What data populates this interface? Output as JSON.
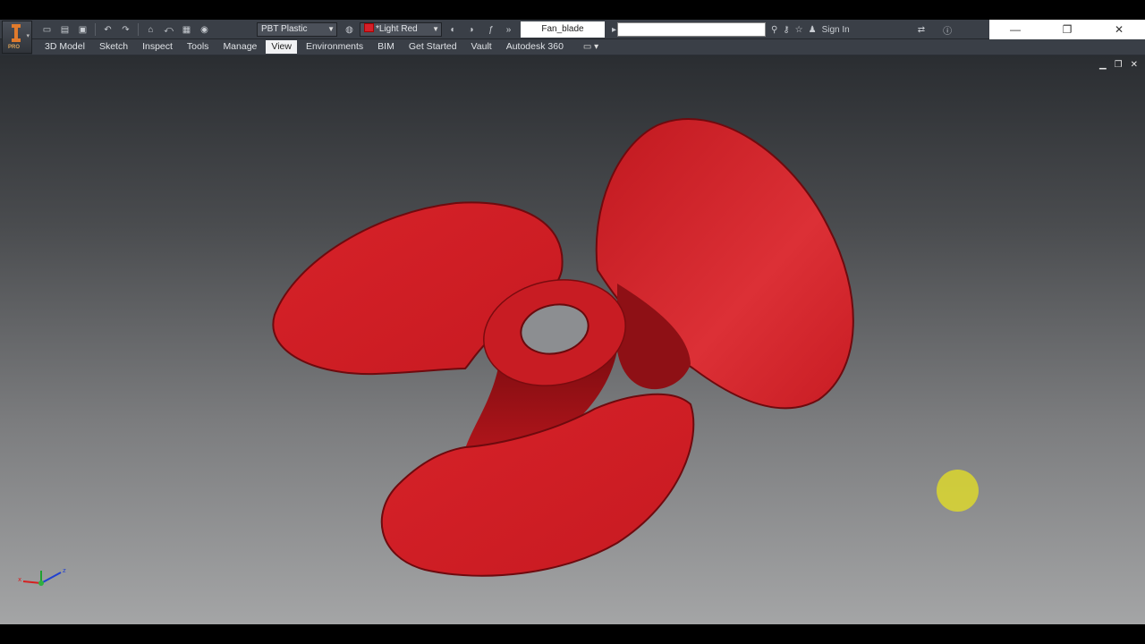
{
  "window": {
    "document_title": "Fan_blade",
    "sign_in_label": "Sign In"
  },
  "toolbar": {
    "material": "PBT Plastic",
    "appearance": "*Light Red",
    "appearance_color": "#d32029"
  },
  "tabs": [
    {
      "label": "3D Model"
    },
    {
      "label": "Sketch"
    },
    {
      "label": "Inspect"
    },
    {
      "label": "Tools"
    },
    {
      "label": "Manage"
    },
    {
      "label": "View",
      "active": true
    },
    {
      "label": "Environments"
    },
    {
      "label": "BIM"
    },
    {
      "label": "Get Started"
    },
    {
      "label": "Vault"
    },
    {
      "label": "Autodesk 360"
    }
  ],
  "app_badge": "PRO",
  "model_color": "#d32029",
  "cursor_color": "#e1dc28"
}
